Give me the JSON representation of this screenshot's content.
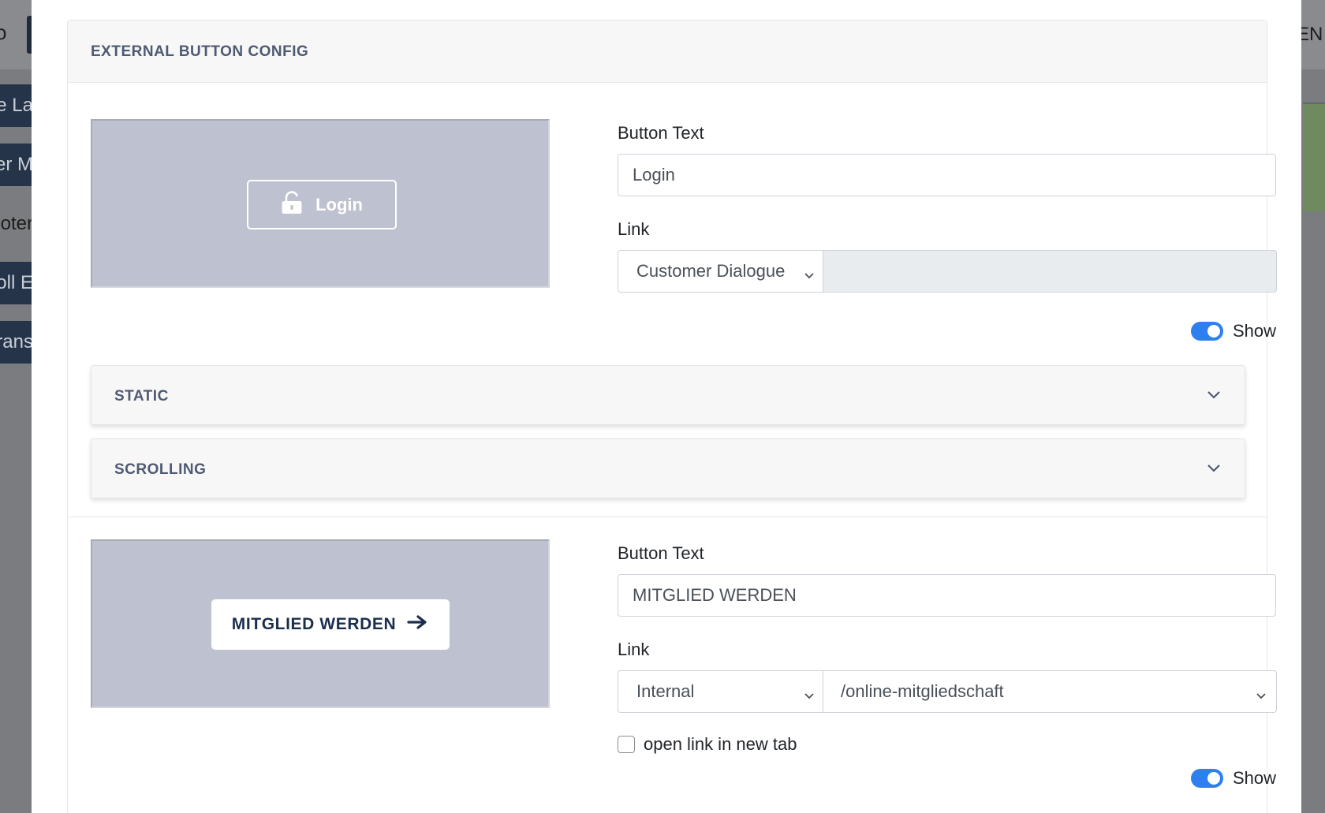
{
  "background": {
    "top_glyph": "o",
    "lang": "EN",
    "sidebar_fragments": [
      "e La",
      "er M",
      "oter",
      "roll E",
      "rans"
    ]
  },
  "modal": {
    "title": "EXTERNAL BUTTON CONFIG",
    "static_button": {
      "preview_label": "Login",
      "preview_icon": "unlock-icon",
      "text_label": "Button Text",
      "text_value": "Login",
      "link_label": "Link",
      "link_type": "Customer Dialogue",
      "link_target": "",
      "show_label": "Show",
      "show_enabled": true
    },
    "accordions": [
      {
        "title": "STATIC"
      },
      {
        "title": "SCROLLING"
      }
    ],
    "scroll_button": {
      "preview_label": "MITGLIED WERDEN",
      "preview_icon": "arrow-right-icon",
      "text_label": "Button Text",
      "text_value": "MITGLIED WERDEN",
      "link_label": "Link",
      "link_type": "Internal",
      "link_target": "/online-mitgliedschaft",
      "new_tab_label": "open link in new tab",
      "new_tab_checked": false,
      "show_label": "Show",
      "show_enabled": true
    }
  },
  "colors": {
    "accent": "#2e7ff0",
    "preview_bg": "#bec1cf",
    "header_text": "#4f5a72",
    "button_navy": "#1b2e4e"
  }
}
